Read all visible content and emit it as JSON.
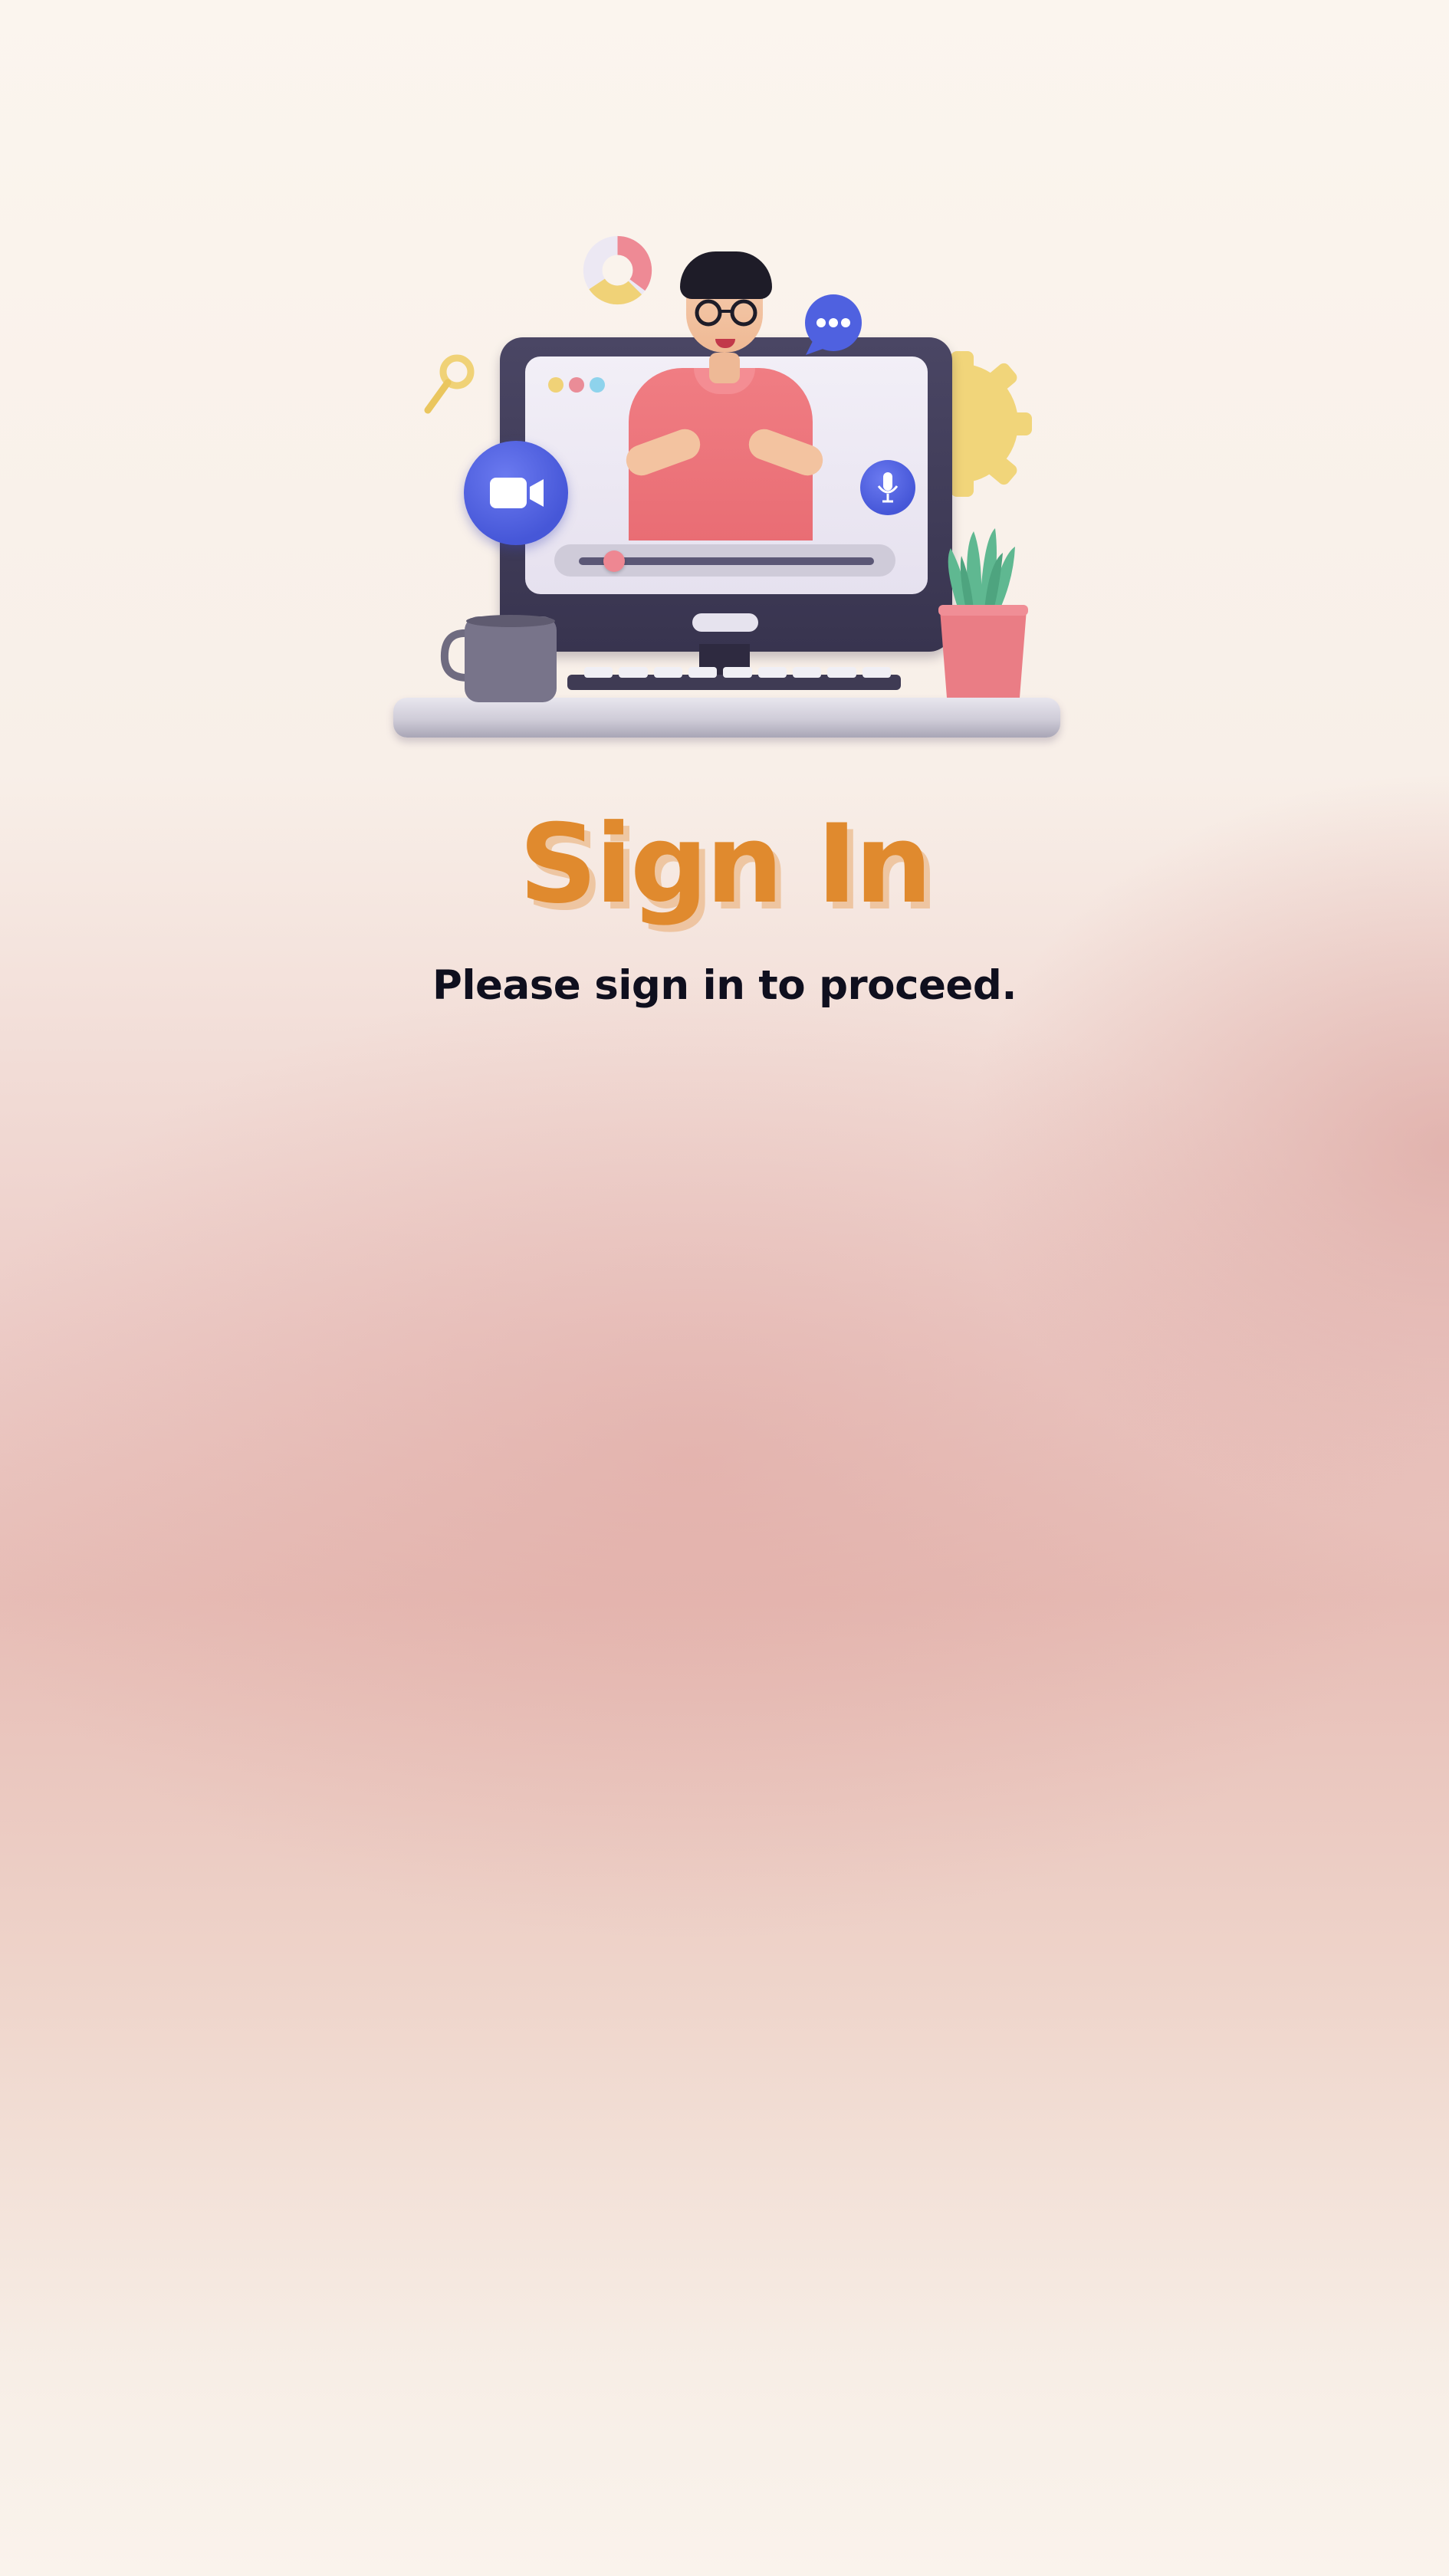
{
  "signin": {
    "title": "Sign In",
    "subtitle": "Please sign in to proceed."
  },
  "illustration": {
    "icons": [
      "video-camera-icon",
      "microphone-icon",
      "chat-bubble-icon",
      "donut-chart-icon",
      "magnifier-icon",
      "gear-icon",
      "coffee-mug-icon",
      "plant-icon"
    ],
    "video_progress_fraction": 0.12
  },
  "colors": {
    "title": "#e08a2e",
    "title_shadow": "#e8aa6e",
    "subtitle": "#0f0f1e",
    "accent_blue": "#4657d8",
    "accent_pink": "#ee8792",
    "accent_yellow": "#f0d277"
  }
}
